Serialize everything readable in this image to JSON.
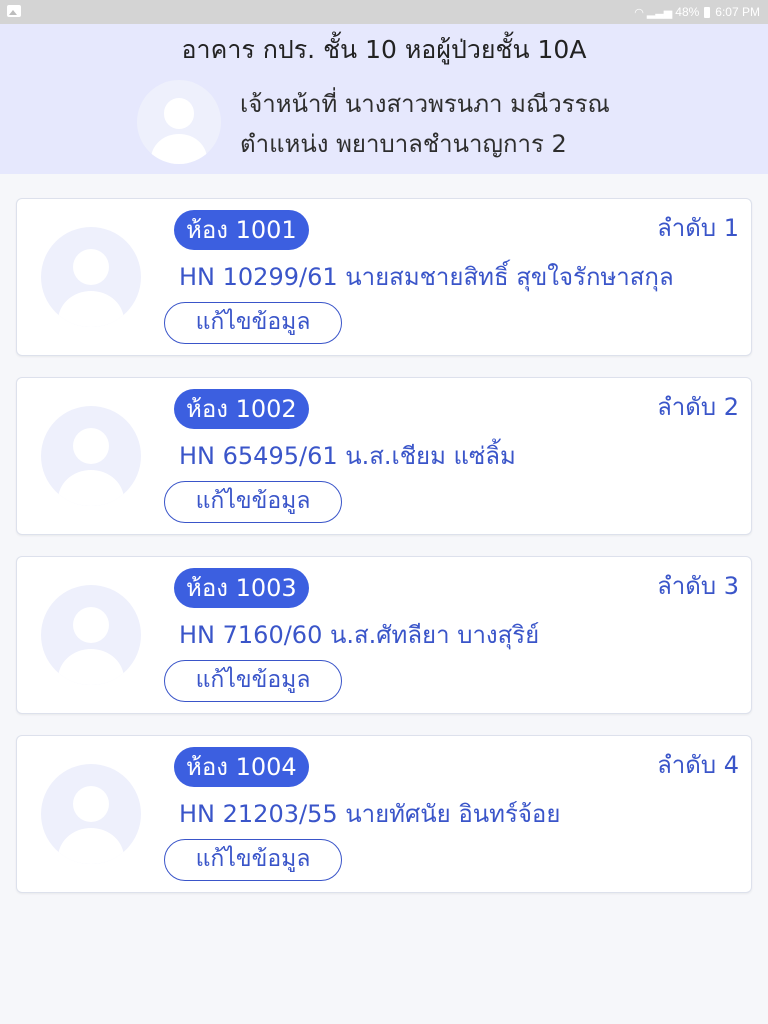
{
  "status_bar": {
    "battery": "48%",
    "time": "6:07 PM",
    "icons": [
      "image-icon",
      "wifi-icon",
      "signal-icon",
      "battery-icon"
    ]
  },
  "header": {
    "title": "อาคาร กปร. ชั้น 10 หอผู้ป่วยชั้น 10A",
    "staff_name": "เจ้าหน้าที่ นางสาวพรนภา มณีวรรณ",
    "staff_position": "ตำแหน่ง พยาบาลชำนาญการ 2"
  },
  "patients": [
    {
      "room": "ห้อง 1001",
      "order": "ลำดับ 1",
      "info": "HN 10299/61 นายสมชายสิทธิ์ สุขใจรักษาสกุล",
      "edit_label": "แก้ไขข้อมูล"
    },
    {
      "room": "ห้อง 1002",
      "order": "ลำดับ 2",
      "info": "HN 65495/61 น.ส.เชียม แซ่ลิ้ม",
      "edit_label": "แก้ไขข้อมูล"
    },
    {
      "room": "ห้อง 1003",
      "order": "ลำดับ 3",
      "info": "HN 7160/60 น.ส.ศัทลียา บางสุริย์",
      "edit_label": "แก้ไขข้อมูล"
    },
    {
      "room": "ห้อง 1004",
      "order": "ลำดับ 4",
      "info": "HN 21203/55 นายทัศนัย อินทร์จ้อย",
      "edit_label": "แก้ไขข้อมูล"
    }
  ],
  "colors": {
    "accent": "#3c5fe0",
    "text_blue": "#3a55c9",
    "header_bg": "#e6e8fd",
    "avatar_bg": "#eef0fc",
    "status_bar_bg": "#d4d4d4"
  }
}
